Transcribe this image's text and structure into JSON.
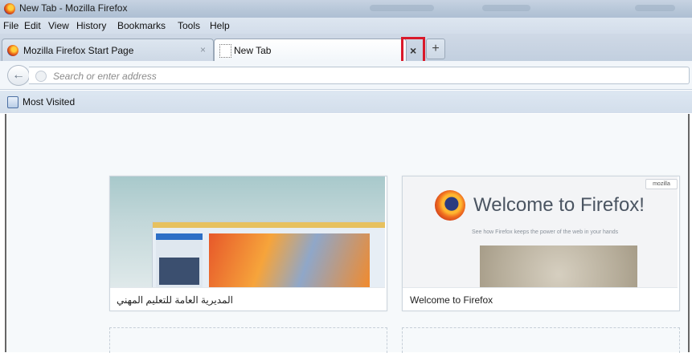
{
  "window": {
    "title": "New Tab - Mozilla Firefox"
  },
  "menubar": {
    "items": [
      "File",
      "Edit",
      "View",
      "History",
      "Bookmarks",
      "Tools",
      "Help"
    ]
  },
  "tabs": [
    {
      "label": "Mozilla Firefox Start Page",
      "close": "×",
      "active": false
    },
    {
      "label": "New Tab",
      "active": true
    }
  ],
  "tab_controls": {
    "close_label": "×",
    "new_tab_label": "+"
  },
  "navbar": {
    "back_icon": "back-arrow-icon",
    "search_placeholder": "Search or enter address"
  },
  "bookmarks": {
    "most_visited": "Most Visited"
  },
  "tiles": [
    {
      "caption": "المديرية العامة للتعليم المهني"
    },
    {
      "caption": "Welcome to Firefox",
      "preview_title": "Welcome to Firefox!",
      "preview_subtitle": "See how Firefox keeps the power of the web in your hands",
      "preview_tag": "mozilla"
    }
  ],
  "colors": {
    "highlight": "#d9192a",
    "tabstrip": "#c2cfdf",
    "bookmarks_bar": "#d3deeb"
  }
}
